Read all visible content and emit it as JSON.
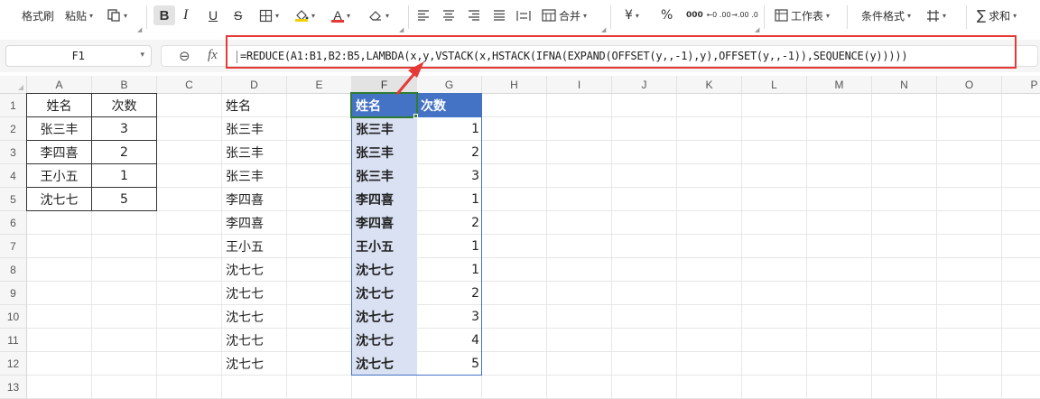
{
  "toolbar": {
    "format_painter": "格式刷",
    "paste": "粘贴",
    "copy_icon": "copy-icon",
    "bold": "B",
    "italic": "I",
    "underline": "U",
    "strike": "S",
    "border_icon": "border-icon",
    "fill_color": "#f5d000",
    "font_color": "#e53935",
    "eraser_icon": "eraser-icon",
    "merge": "合并",
    "currency": "¥",
    "percent": "%",
    "thousands": "000",
    "dec_increase": "←0 .00",
    "dec_decrease": "→.00 .0",
    "worksheet": "工作表",
    "conditional_format": "条件格式",
    "freeze_icon": "freeze-icon",
    "sum": "求和",
    "sum_symbol": "∑"
  },
  "formula_bar": {
    "name_box": "F1",
    "fx": "fx",
    "formula": "=REDUCE(A1:B1,B2:B5,LAMBDA(x,y,VSTACK(x,HSTACK(IFNA(EXPAND(OFFSET(y,,-1),y),OFFSET(y,,-1)),SEQUENCE(y)))))"
  },
  "sheet": {
    "columns": [
      "A",
      "B",
      "C",
      "D",
      "E",
      "F",
      "G",
      "H",
      "I",
      "J",
      "K",
      "L",
      "M",
      "N",
      "O",
      "P"
    ],
    "rows": [
      "1",
      "2",
      "3",
      "4",
      "5",
      "6",
      "7",
      "8",
      "9",
      "10",
      "11",
      "12",
      "13"
    ],
    "selected_cell": "F1",
    "source_table": {
      "headers": [
        "姓名",
        "次数"
      ],
      "rows": [
        [
          "张三丰",
          "3"
        ],
        [
          "李四喜",
          "2"
        ],
        [
          "王小五",
          "1"
        ],
        [
          "沈七七",
          "5"
        ]
      ]
    },
    "col_d": [
      "姓名",
      "张三丰",
      "张三丰",
      "张三丰",
      "李四喜",
      "李四喜",
      "王小五",
      "沈七七",
      "沈七七",
      "沈七七",
      "沈七七",
      "沈七七"
    ],
    "result_table": {
      "headers": [
        "姓名",
        "次数"
      ],
      "rows": [
        [
          "张三丰",
          "1"
        ],
        [
          "张三丰",
          "2"
        ],
        [
          "张三丰",
          "3"
        ],
        [
          "李四喜",
          "1"
        ],
        [
          "李四喜",
          "2"
        ],
        [
          "王小五",
          "1"
        ],
        [
          "沈七七",
          "1"
        ],
        [
          "沈七七",
          "2"
        ],
        [
          "沈七七",
          "3"
        ],
        [
          "沈七七",
          "4"
        ],
        [
          "沈七七",
          "5"
        ]
      ]
    },
    "colors": {
      "header_blue": "#4472c4",
      "light_blue": "#d9e1f2",
      "selection_green": "#2e7d32",
      "annotation_red": "#e53935"
    }
  }
}
